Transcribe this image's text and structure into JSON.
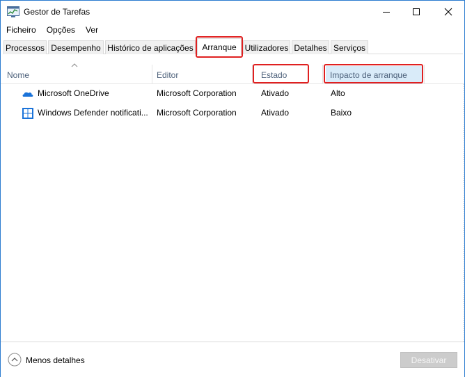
{
  "window": {
    "title": "Gestor de Tarefas",
    "icon": "task-manager-icon"
  },
  "menu": [
    "Ficheiro",
    "Opções",
    "Ver"
  ],
  "tabs": [
    {
      "label": "Processos",
      "active": false
    },
    {
      "label": "Desempenho",
      "active": false
    },
    {
      "label": "Histórico de aplicações",
      "active": false
    },
    {
      "label": "Arranque",
      "active": true
    },
    {
      "label": "Utilizadores",
      "active": false
    },
    {
      "label": "Detalhes",
      "active": false
    },
    {
      "label": "Serviços",
      "active": false
    }
  ],
  "columns": {
    "name": "Nome",
    "publisher": "Editor",
    "status": "Estado",
    "impact": "Impacto de arranque"
  },
  "rows": [
    {
      "icon": "onedrive-icon",
      "name": "Microsoft OneDrive",
      "publisher": "Microsoft Corporation",
      "status": "Ativado",
      "impact": "Alto"
    },
    {
      "icon": "windows-defender-icon",
      "name": "Windows Defender notificati...",
      "publisher": "Microsoft Corporation",
      "status": "Ativado",
      "impact": "Baixo"
    }
  ],
  "footer": {
    "less_details": "Menos detalhes",
    "disable_button": "Desativar"
  },
  "colors": {
    "highlight_box": "#e02020",
    "accent": "#2b7bd0",
    "header_text": "#4c607a",
    "selected_column_bg": "#d9ebf9"
  }
}
